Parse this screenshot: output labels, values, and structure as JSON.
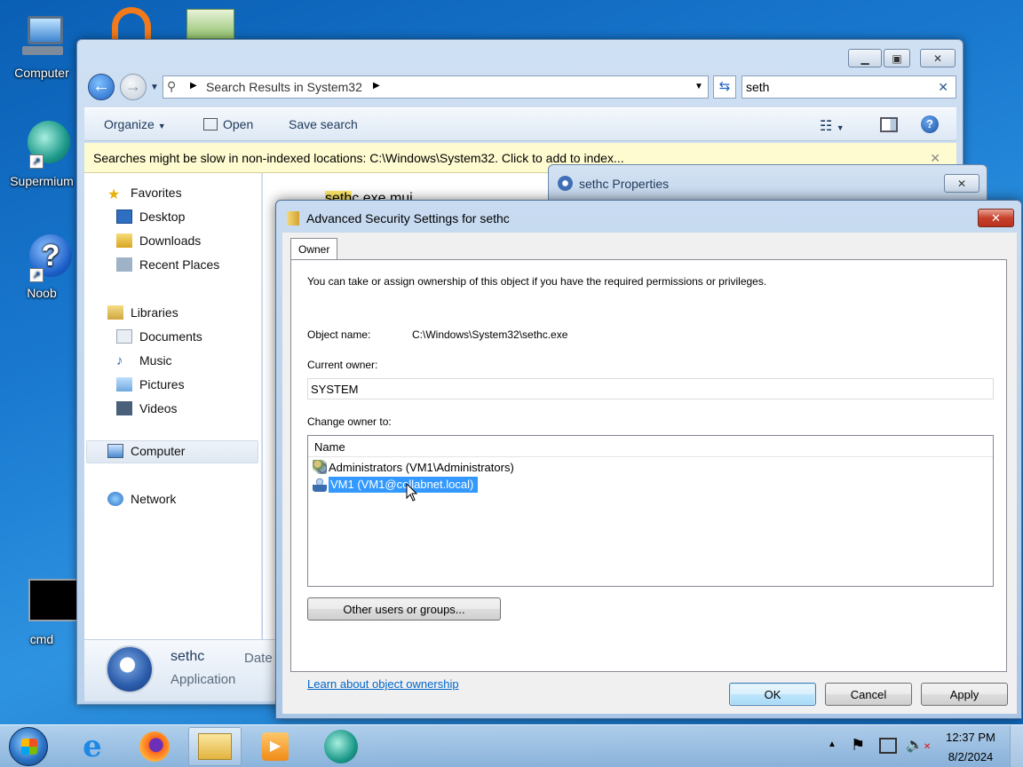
{
  "desktop": {
    "icons": [
      {
        "label": "Computer"
      },
      {
        "label": "Supermium"
      },
      {
        "label": "Noob"
      },
      {
        "label": "cmd"
      }
    ]
  },
  "explorer": {
    "address": "Search Results in System32",
    "search_value": "seth",
    "toolbar": {
      "organize": "Organize",
      "open": "Open",
      "save_search": "Save search"
    },
    "infobar": "Searches might be slow in non-indexed locations: C:\\Windows\\System32. Click to add to index...",
    "nav": {
      "favorites": "Favorites",
      "desktop": "Desktop",
      "downloads": "Downloads",
      "recent": "Recent Places",
      "libraries": "Libraries",
      "documents": "Documents",
      "music": "Music",
      "pictures": "Pictures",
      "videos": "Videos",
      "computer": "Computer",
      "network": "Network"
    },
    "content_file_highlight": "seth",
    "content_file_rest": "c.exe.mui",
    "details": {
      "name": "sethc",
      "type": "Application",
      "date_label": "Date"
    }
  },
  "properties": {
    "title": "sethc Properties"
  },
  "advanced": {
    "title": "Advanced Security Settings for sethc",
    "tab": "Owner",
    "intro": "You can take or assign ownership of this object if you have the required permissions or privileges.",
    "object_name_label": "Object name:",
    "object_name_value": "C:\\Windows\\System32\\sethc.exe",
    "current_owner_label": "Current owner:",
    "current_owner_value": "SYSTEM",
    "change_owner_label": "Change owner to:",
    "list_header": "Name",
    "owners": [
      {
        "name": "Administrators (VM1\\Administrators)",
        "selected": false
      },
      {
        "name": "VM1 (VM1@collabnet.local)",
        "selected": true
      }
    ],
    "other_users_button": "Other users or groups...",
    "learn_link": "Learn about object ownership",
    "ok": "OK",
    "cancel": "Cancel",
    "apply": "Apply"
  },
  "taskbar": {
    "time": "12:37 PM",
    "date": "8/2/2024"
  }
}
